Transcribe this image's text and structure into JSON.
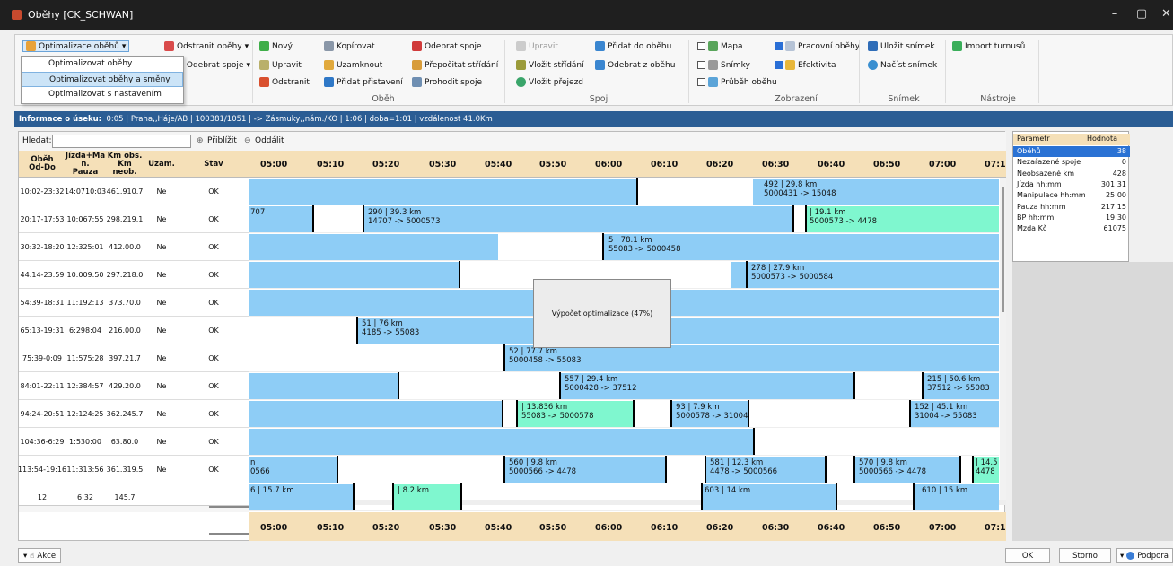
{
  "window": {
    "title": "Oběhy [CK_SCHWAN]"
  },
  "ribbon": {
    "optimize_label": "Optimalizace oběhů",
    "remove_label": "Odstranit oběhy",
    "remove_spoje": "Odebrat spoje",
    "new": "Nový",
    "edit": "Upravit",
    "delete": "Odstranit",
    "copy": "Kopírovat",
    "lock": "Uzamknout",
    "add_transfer": "Přidat přistavení",
    "remove_spoje2": "Odebrat spoje",
    "recalc": "Přepočitat střídání",
    "swap": "Prohodit spoje",
    "edit2": "Upravit",
    "insert_exchange": "Vložit střídání",
    "insert_transit": "Vložit přejezd",
    "add_to": "Přidat do oběhu",
    "remove_from": "Odebrat z oběhu",
    "map": "Mapa",
    "snapshots": "Snímky",
    "course": "Průběh oběhu",
    "working": "Pracovní oběhy",
    "efficiency": "Efektivita",
    "save_snap": "Uložit snímek",
    "load_snap": "Načíst snímek",
    "import": "Import turnusů",
    "groups": {
      "obeh": "Oběh",
      "spoj": "Spoj",
      "zobrazeni": "Zobrazení",
      "snimek": "Snímek",
      "nastroje": "Nástroje"
    }
  },
  "dropdown": [
    "Optimalizovat oběhy",
    "Optimalizovat oběhy a směny",
    "Optimalizovat s nastavením"
  ],
  "infobar": {
    "label": "Informace o úseku:",
    "text": "0:05 | Praha,,Háje/AB | 100381/1051 |  -> Zásmuky,,nám./KO | 1:06 | doba=1:01 | vzdálenost 41.0Km"
  },
  "search": {
    "label": "Hledat:",
    "zoom_in": "Přiblížit",
    "zoom_out": "Oddálit"
  },
  "headers": {
    "obeh": "Oběh\nOd-Do",
    "jizda": "Jízda+Ma\nn.\nPauza",
    "km": "Km obs.\nKm\nneob.",
    "uzam": "Uzam.",
    "stav": "Stav"
  },
  "timeline": [
    "05:00",
    "05:10",
    "05:20",
    "05:30",
    "05:40",
    "05:50",
    "06:00",
    "06:10",
    "06:20",
    "06:30",
    "06:40",
    "06:50",
    "07:00",
    "07:1"
  ],
  "rows": [
    {
      "id": "1",
      "range": "0:02-23:32",
      "jizda": "14:07",
      "pauza": "10:03",
      "km": "461.9",
      "kmn": "10.7",
      "uzam": "Ne",
      "stav": "OK"
    },
    {
      "id": "2",
      "range": "0:17-17:53",
      "jizda": "10:06",
      "pauza": "7:55",
      "km": "298.2",
      "kmn": "19.1",
      "uzam": "Ne",
      "stav": "OK"
    },
    {
      "id": "3",
      "range": "0:32-18:20",
      "jizda": "12:32",
      "pauza": "5:01",
      "km": "412.0",
      "kmn": "0.0",
      "uzam": "Ne",
      "stav": "OK"
    },
    {
      "id": "4",
      "range": "4:14-23:59",
      "jizda": "10:00",
      "pauza": "9:50",
      "km": "297.2",
      "kmn": "18.0",
      "uzam": "Ne",
      "stav": "OK"
    },
    {
      "id": "5",
      "range": "4:39-18:31",
      "jizda": "11:19",
      "pauza": "2:13",
      "km": "373.7",
      "kmn": "0.0",
      "uzam": "Ne",
      "stav": "OK"
    },
    {
      "id": "6",
      "range": "5:13-19:31",
      "jizda": "6:29",
      "pauza": "8:04",
      "km": "216.0",
      "kmn": "0.0",
      "uzam": "Ne",
      "stav": "OK"
    },
    {
      "id": "7",
      "range": "5:39-0:09",
      "jizda": "11:57",
      "pauza": "5:28",
      "km": "397.2",
      "kmn": "1.7",
      "uzam": "Ne",
      "stav": "OK"
    },
    {
      "id": "8",
      "range": "4:01-22:11",
      "jizda": "12:38",
      "pauza": "4:57",
      "km": "429.2",
      "kmn": "0.0",
      "uzam": "Ne",
      "stav": "OK"
    },
    {
      "id": "9",
      "range": "4:24-20:51",
      "jizda": "12:12",
      "pauza": "4:25",
      "km": "362.2",
      "kmn": "45.7",
      "uzam": "Ne",
      "stav": "OK"
    },
    {
      "id": "10",
      "range": "4:36-6:29",
      "jizda": "1:53",
      "pauza": "0:00",
      "km": "63.8",
      "kmn": "0.0",
      "uzam": "Ne",
      "stav": "OK"
    },
    {
      "id": "11",
      "range": "3:54-19:16",
      "jizda": "11:31",
      "pauza": "3:56",
      "km": "361.3",
      "kmn": "19.5",
      "uzam": "Ne",
      "stav": "OK"
    },
    {
      "id": "12",
      "range": "",
      "jizda": "6:32",
      "pauza": "",
      "km": "145.7",
      "kmn": "",
      "uzam": "",
      "stav": ""
    }
  ],
  "gantt_labels": [
    "492 | 29.8 km\n5000431 -> 15048",
    "707",
    "290 | 39.3 km\n14707 -> 5000573",
    "| 19.1 km\n5000573 -> 4478",
    "5 | 78.1 km\n55083 -> 5000458",
    "278 | 27.9 km\n5000573 -> 5000584",
    "51 | 76 km\n4185 -> 55083",
    "52 | 77.7 km\n5000458 -> 55083",
    "557 | 29.4 km\n5000428 -> 37512",
    "215 | 50.6 km\n37512 -> 55083",
    "| 13.836 km\n55083 -> 5000578",
    "93 | 7.9 km\n5000578 -> 31004",
    "152 | 45.1 km\n31004 -> 55083",
    "n\n0566",
    "560 | 9.8 km\n5000566 -> 4478",
    "581 | 12.3 km\n4478 -> 5000566",
    "570 | 9.8 km\n5000566 -> 4478",
    "| 14.5\n4478",
    "6 | 15.7 km",
    "| 8.2 km",
    "603 | 14 km",
    "610 | 15 km"
  ],
  "popup": "Výpočet optimalizace (47%)",
  "params": {
    "head": [
      "Parametr",
      "Hodnota"
    ],
    "rows": [
      [
        "Oběhů",
        "38"
      ],
      [
        "Nezařazené spoje",
        "0"
      ],
      [
        "Neobsazené km",
        "428"
      ],
      [
        "Jízda hh:mm",
        "301:31"
      ],
      [
        "Manipulace hh:mm",
        "25:00"
      ],
      [
        "Pauza hh:mm",
        "217:15"
      ],
      [
        "BP hh:mm",
        "19:30"
      ],
      [
        "Mzda Kč",
        "61075"
      ]
    ]
  },
  "footer": {
    "akce": "Akce",
    "ok": "OK",
    "storno": "Storno",
    "podpora": "Podpora"
  },
  "colors": {
    "blue": "#8ecdf6",
    "green": "#7ff7cf",
    "header": "#f5e0b8",
    "info": "#2b5d94"
  }
}
